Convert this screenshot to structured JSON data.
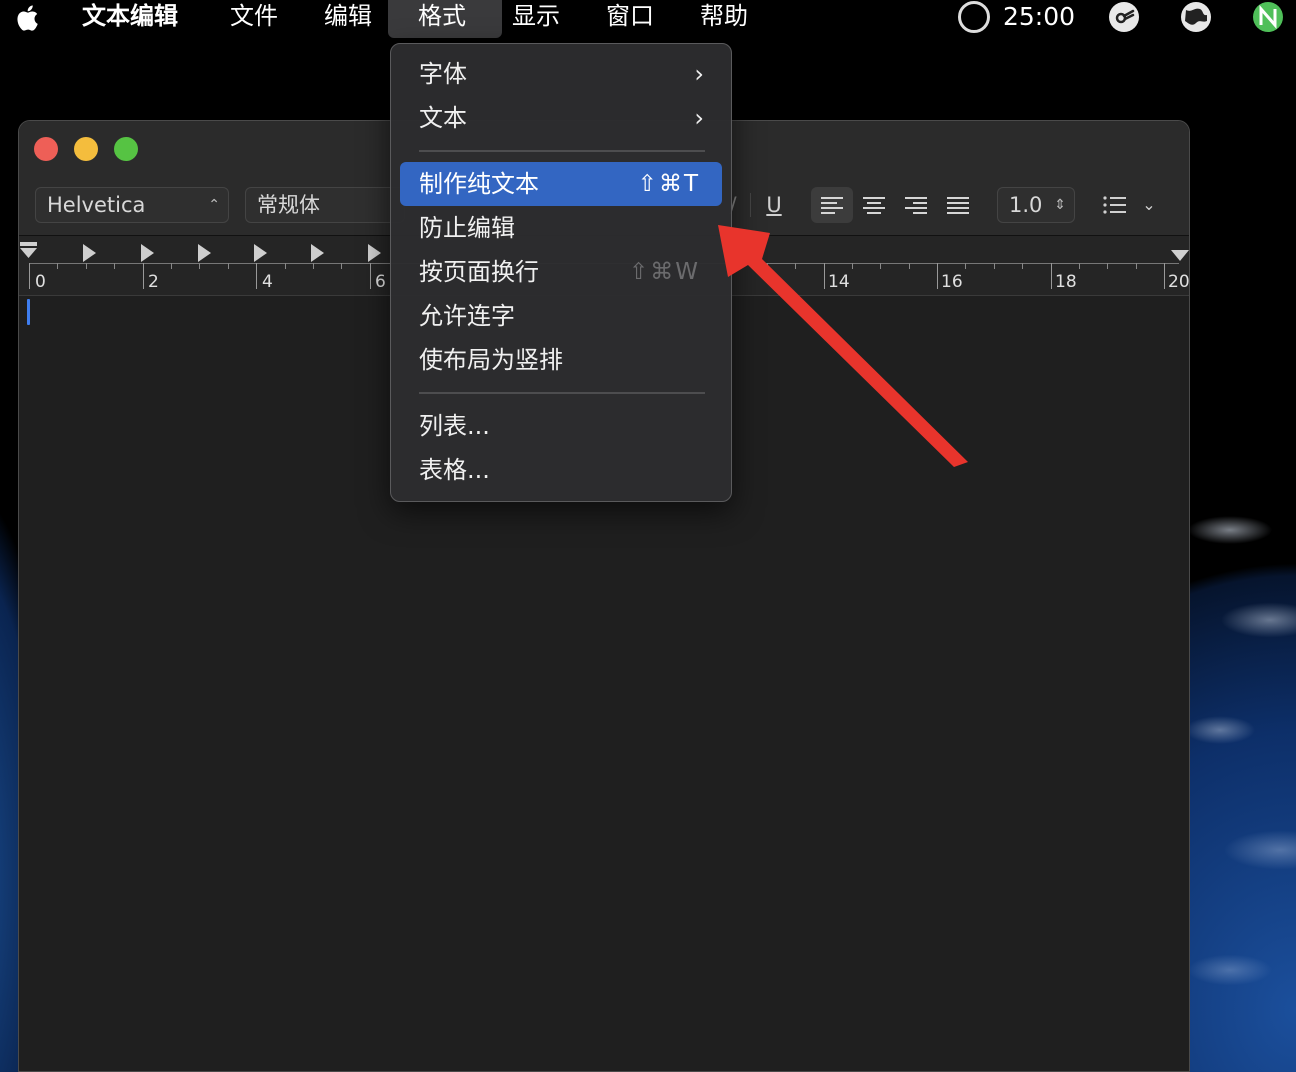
{
  "menubar": {
    "app_name": "文本编辑",
    "items": [
      "文件",
      "编辑",
      "格式",
      "显示",
      "窗口",
      "帮助"
    ],
    "timer": "25:00"
  },
  "toolbar": {
    "font_family": "Helvetica",
    "font_style": "常规体",
    "underline_label": "U",
    "line_spacing": "1.0"
  },
  "ruler": {
    "labels": [
      "0",
      "2",
      "4",
      "6",
      "14",
      "16",
      "18",
      "20"
    ]
  },
  "format_menu": {
    "items": [
      {
        "label": "字体",
        "submenu": true
      },
      {
        "label": "文本",
        "submenu": true
      },
      {
        "label": "制作纯文本",
        "shortcut": "⇧⌘T",
        "highlighted": true
      },
      {
        "label": "防止编辑"
      },
      {
        "label": "按页面换行",
        "shortcut": "⇧⌘W",
        "disabled_shortcut": true
      },
      {
        "label": "允许连字"
      },
      {
        "label": "使布局为竖排"
      },
      {
        "label": "列表..."
      },
      {
        "label": "表格..."
      }
    ]
  },
  "colors": {
    "highlight": "#3366c2",
    "annotation_arrow": "#e8342c",
    "close": "#ee5f57",
    "minimize": "#f4bd3d",
    "maximize": "#56c343"
  },
  "icons": [
    "apple-icon",
    "timer-icon",
    "status-app-icon",
    "globe-icon",
    "n-app-icon",
    "chevron-right-icon",
    "list-icon",
    "chevron-down-icon"
  ]
}
